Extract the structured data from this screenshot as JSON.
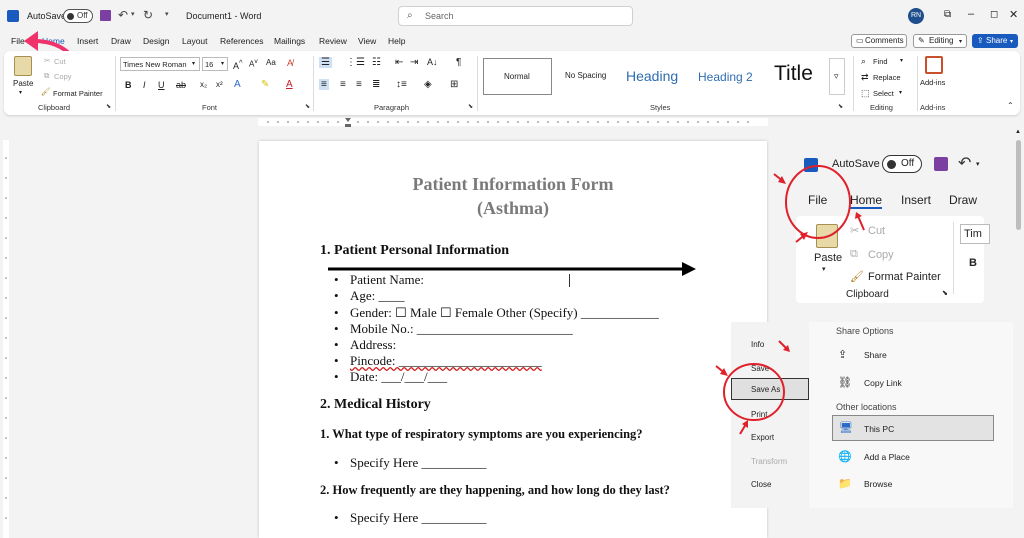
{
  "titlebar": {
    "autosave_label": "AutoSave",
    "autosave_state": "Off",
    "doc_title": "Document1 - Word",
    "search_placeholder": "Search",
    "avatar_initials": "RN"
  },
  "menu": {
    "tabs": [
      "File",
      "Home",
      "Insert",
      "Draw",
      "Design",
      "Layout",
      "References",
      "Mailings",
      "Review",
      "View",
      "Help"
    ],
    "comments_label": "Comments",
    "editing_label": "Editing",
    "share_label": "Share"
  },
  "ribbon": {
    "clipboard": {
      "paste": "Paste",
      "cut": "Cut",
      "copy": "Copy",
      "format_painter": "Format Painter",
      "group": "Clipboard"
    },
    "font": {
      "font_name": "Times New Roman",
      "font_size": "16",
      "group": "Font"
    },
    "paragraph": {
      "group": "Paragraph"
    },
    "styles": {
      "items": [
        "Normal",
        "No Spacing",
        "Heading",
        "Heading 2",
        "Title"
      ],
      "group": "Styles"
    },
    "editing": {
      "find": "Find",
      "replace": "Replace",
      "select": "Select",
      "group": "Editing"
    },
    "addins": {
      "label": "Add-ins",
      "group": "Add-ins"
    }
  },
  "document": {
    "title_line1": "Patient Information Form",
    "title_line2": "(Asthma)",
    "section1": "1. Patient Personal Information",
    "fields": [
      "Patient Name:",
      "Age: ____",
      "Gender: ☐ Male ☐ Female Other (Specify) ____________",
      "Mobile No.: ________________________",
      "Address:",
      "Pincode: ______________________",
      "Date: ___/___/___"
    ],
    "section2": "2. Medical History",
    "q1": "1. What type of respiratory symptoms are you experiencing?",
    "q1_answer": "Specify Here __________",
    "q2": "2. How frequently are they happening, and how long do they last?",
    "q2_answer": "Specify Here __________"
  },
  "inset_quick": {
    "autosave_label": "AutoSave",
    "autosave_state": "Off",
    "tabs": [
      "File",
      "Home",
      "Insert",
      "Draw"
    ],
    "paste": "Paste",
    "cut": "Cut",
    "copy": "Copy",
    "format_painter": "Format Painter",
    "group": "Clipboard",
    "font_partial": "Tim",
    "bold": "B"
  },
  "inset_backstage": {
    "left_items": [
      "Info",
      "Save",
      "Save As",
      "Print",
      "Export",
      "Transform",
      "Close"
    ],
    "share_options_title": "Share Options",
    "share": "Share",
    "copy_link": "Copy Link",
    "other_locations_title": "Other locations",
    "this_pc": "This PC",
    "add_place": "Add a Place",
    "browse": "Browse"
  },
  "colors": {
    "accent_blue": "#185abd",
    "annotation_red": "#e0202a",
    "pink_arrow": "#f0326a"
  }
}
